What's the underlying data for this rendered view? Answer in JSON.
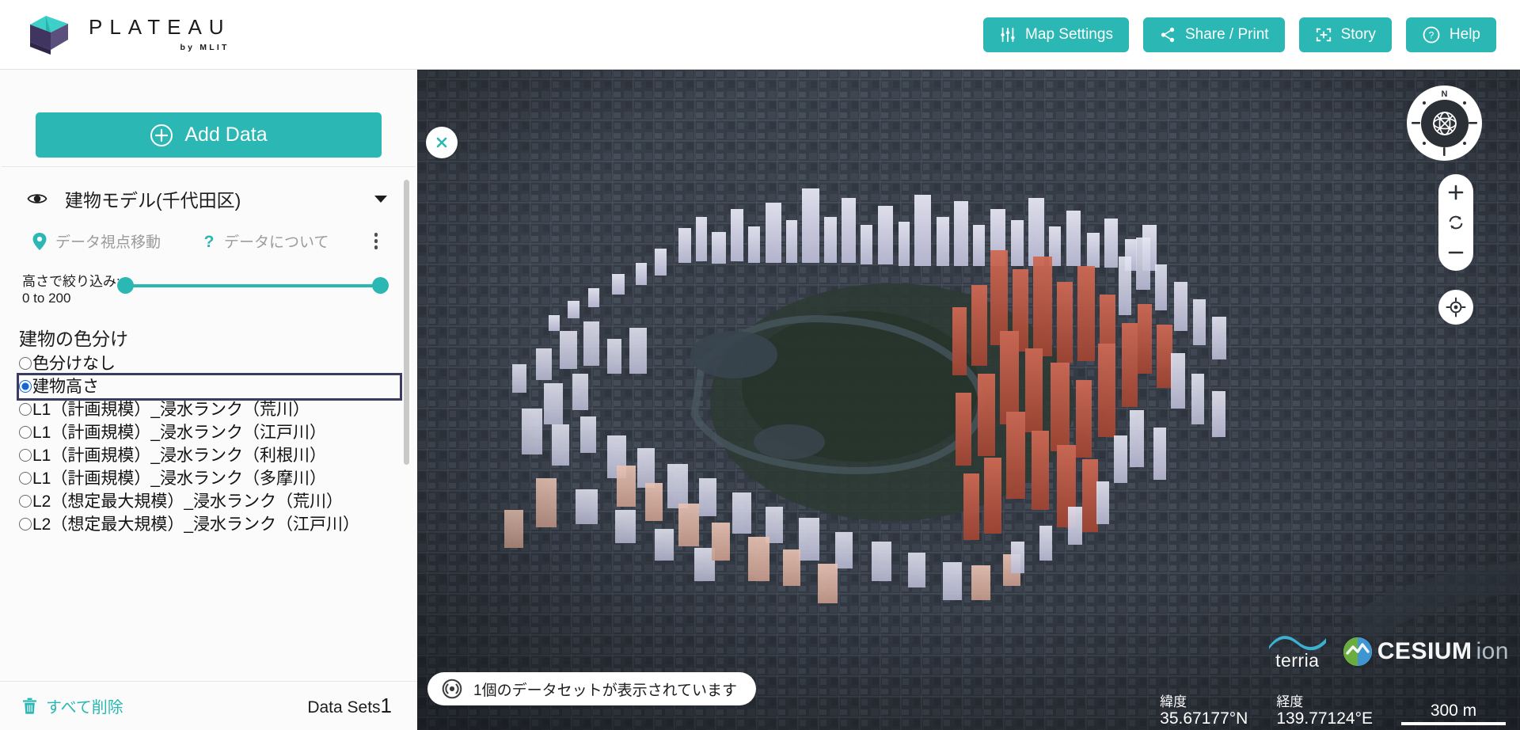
{
  "header": {
    "brand_title": "PLATEAU",
    "brand_sub": "by MLIT",
    "buttons": [
      {
        "label": "Map Settings",
        "icon": "sliders-icon"
      },
      {
        "label": "Share / Print",
        "icon": "share-icon"
      },
      {
        "label": "Story",
        "icon": "story-frame-icon"
      },
      {
        "label": "Help",
        "icon": "question-circle-icon"
      }
    ]
  },
  "sidebar": {
    "add_data_label": "Add Data",
    "layer": {
      "title": "建物モデル(千代田区)",
      "visibility_icon": "eye-icon",
      "menu_icon": "kebab-menu-icon",
      "actions": [
        {
          "label": "データ視点移動",
          "icon": "map-pin-icon"
        },
        {
          "label": "データについて",
          "icon": "question-mark-icon"
        }
      ]
    },
    "height_filter": {
      "label": "高さで絞り込み:",
      "range_text": "0 to 200",
      "min": 0,
      "max": 200
    },
    "colorize": {
      "title": "建物の色分け",
      "selected_index": 1,
      "options": [
        "色分けなし",
        "建物高さ",
        "L1（計画規模）_浸水ランク（荒川）",
        "L1（計画規模）_浸水ランク（江戸川）",
        "L1（計画規模）_浸水ランク（利根川）",
        "L1（計画規模）_浸水ランク（多摩川）",
        "L2（想定最大規模）_浸水ランク（荒川）",
        "L2（想定最大規模）_浸水ランク（江戸川）"
      ]
    },
    "footer": {
      "delete_all_label": "すべて削除",
      "delete_icon": "trash-icon",
      "datasets_label": "Data Sets",
      "datasets_count": "1"
    }
  },
  "map": {
    "close_panel_icon": "close-icon",
    "compass": {
      "north_label": "N",
      "icon": "compass-gyro-icon"
    },
    "zoom_controls": {
      "zoom_in_icon": "plus-icon",
      "reset_icon": "refresh-icon",
      "zoom_out_icon": "minus-icon",
      "geolocate_icon": "crosshair-icon"
    },
    "toast": {
      "text": "1個のデータセットが表示されています",
      "icon": "broadcast-icon"
    },
    "credits": [
      {
        "name": "terria",
        "type": "logo"
      },
      {
        "name": "CESIUM",
        "suffix": "ion",
        "type": "logo"
      }
    ],
    "status": {
      "latitude_label": "緯度",
      "latitude_value": "35.67177°N",
      "longitude_label": "経度",
      "longitude_value": "139.77124°E",
      "scale_text": "300 m"
    }
  },
  "colors": {
    "accent": "#2bb7b3",
    "sidebar_bg": "#fbfbfb",
    "text": "#1d1d1d",
    "muted": "#9b9b9b",
    "radio_selected": "#1668d1",
    "focus_ring": "#3f3f68"
  }
}
